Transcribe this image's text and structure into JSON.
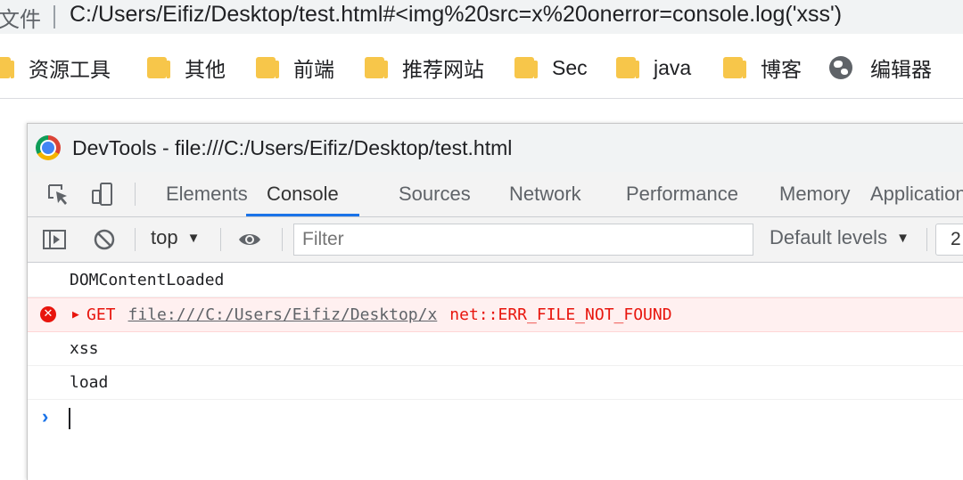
{
  "address_bar": {
    "scheme_label": "文件",
    "url": "C:/Users/Eifiz/Desktop/test.html#<img%20src=x%20onerror=console.log('xss')"
  },
  "bookmarks": [
    {
      "label": "资源工具",
      "icon": "folder-icon"
    },
    {
      "label": "其他",
      "icon": "folder-icon"
    },
    {
      "label": "前端",
      "icon": "folder-icon"
    },
    {
      "label": "推荐网站",
      "icon": "folder-icon"
    },
    {
      "label": "Sec",
      "icon": "folder-icon"
    },
    {
      "label": "java",
      "icon": "folder-icon"
    },
    {
      "label": "博客",
      "icon": "folder-icon"
    },
    {
      "label": "编辑器",
      "icon": "globe-icon"
    }
  ],
  "devtools": {
    "title": "DevTools - file:///C:/Users/Eifiz/Desktop/test.html",
    "tabs": [
      "Elements",
      "Console",
      "Sources",
      "Network",
      "Performance",
      "Memory",
      "Application"
    ],
    "active_tab": "Console",
    "toolbar": {
      "context": "top",
      "filter_placeholder": "Filter",
      "levels": "Default levels",
      "issues_count": "2"
    },
    "console": {
      "messages": [
        {
          "type": "log",
          "text": "DOMContentLoaded"
        },
        {
          "type": "error",
          "method": "GET",
          "url": "file:///C:/Users/Eifiz/Desktop/x",
          "status": "net::ERR_FILE_NOT_FOUND"
        },
        {
          "type": "log",
          "text": "xss"
        },
        {
          "type": "log",
          "text": "load"
        }
      ],
      "prompt_symbol": "›"
    }
  },
  "colors": {
    "accent": "#1a73e8",
    "error": "#e8150d",
    "error_bg": "#fff0f0",
    "folder": "#f7c64a"
  }
}
